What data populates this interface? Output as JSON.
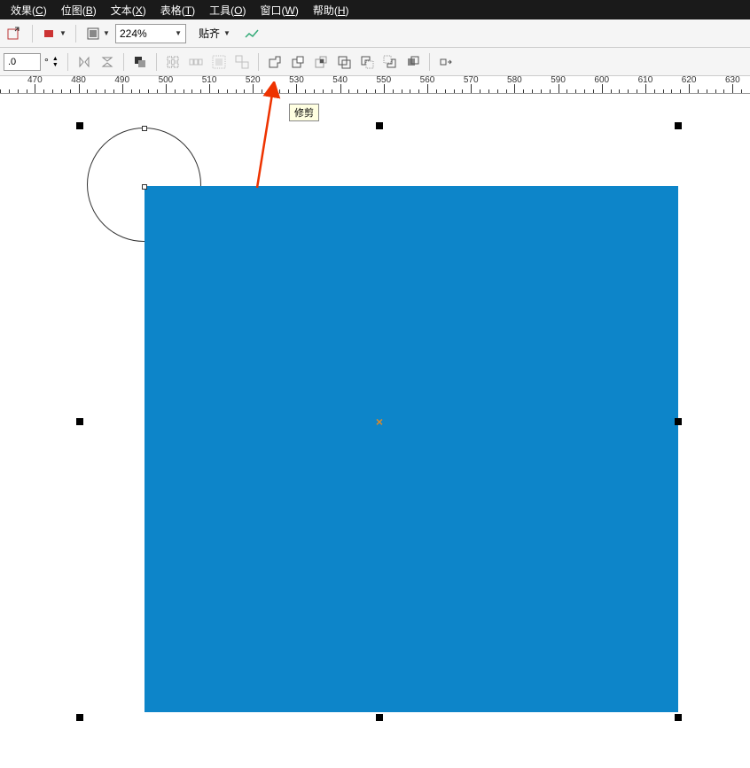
{
  "menu": {
    "items": [
      {
        "label": "效果",
        "key": "C"
      },
      {
        "label": "位图",
        "key": "B"
      },
      {
        "label": "文本",
        "key": "X"
      },
      {
        "label": "表格",
        "key": "T"
      },
      {
        "label": "工具",
        "key": "O"
      },
      {
        "label": "窗口",
        "key": "W"
      },
      {
        "label": "帮助",
        "key": "H"
      }
    ]
  },
  "toolbar1": {
    "zoom_value": "224%",
    "snap_label": "贴齐"
  },
  "toolbar2": {
    "field1_value": ".0",
    "degree_symbol": "°"
  },
  "ruler": {
    "start": 462,
    "end": 634,
    "major_step": 10,
    "minor_step": 2
  },
  "tooltip": {
    "text": "修剪"
  },
  "canvas": {
    "blue_rect_color": "#0d85c9"
  }
}
